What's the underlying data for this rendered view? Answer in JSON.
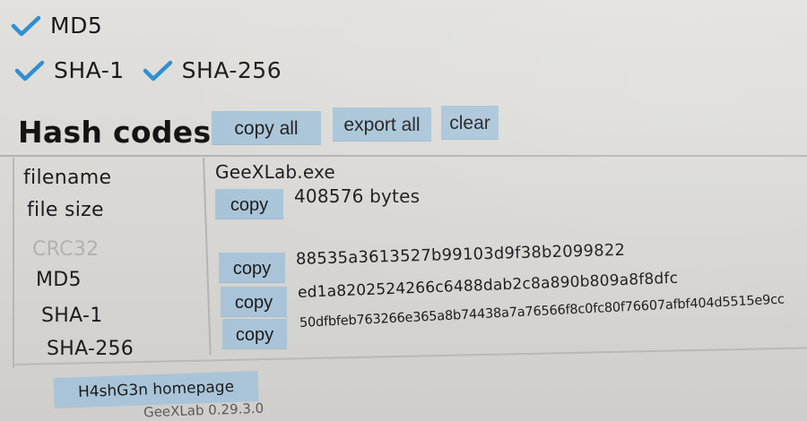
{
  "checkboxes": {
    "md5": {
      "label": "MD5",
      "checked": true
    },
    "sha1": {
      "label": "SHA-1",
      "checked": true
    },
    "sha256": {
      "label": "SHA-256",
      "checked": true
    }
  },
  "hash_section": {
    "title": "Hash codes",
    "copy_all": "copy all",
    "export_all": "export all",
    "clear": "clear"
  },
  "rows": {
    "filename": {
      "label": "filename",
      "value": "GeeXLab.exe"
    },
    "filesize": {
      "label": "file size",
      "value": "408576 bytes"
    },
    "crc32": {
      "label": "CRC32",
      "value": ""
    },
    "md5": {
      "label": "MD5",
      "value": "88535a3613527b99103d9f38b2099822"
    },
    "sha1": {
      "label": "SHA-1",
      "value": "ed1a8202524266c6488dab2c8a890b809a8f8dfc"
    },
    "sha256": {
      "label": "SHA-256",
      "value": "50dfbfeb763266e365a8b74438a7a76566f8c0fc80f76607afbf404d5515e9cc"
    }
  },
  "copy_label": "copy",
  "footer": {
    "homepage_button": "H4shG3n homepage",
    "version_text": "GeeXLab 0.29.3.0"
  },
  "colors": {
    "check": "#2f8fd3",
    "button_bg": "#a9c4d8",
    "panel_bg": "#dad9d5"
  }
}
